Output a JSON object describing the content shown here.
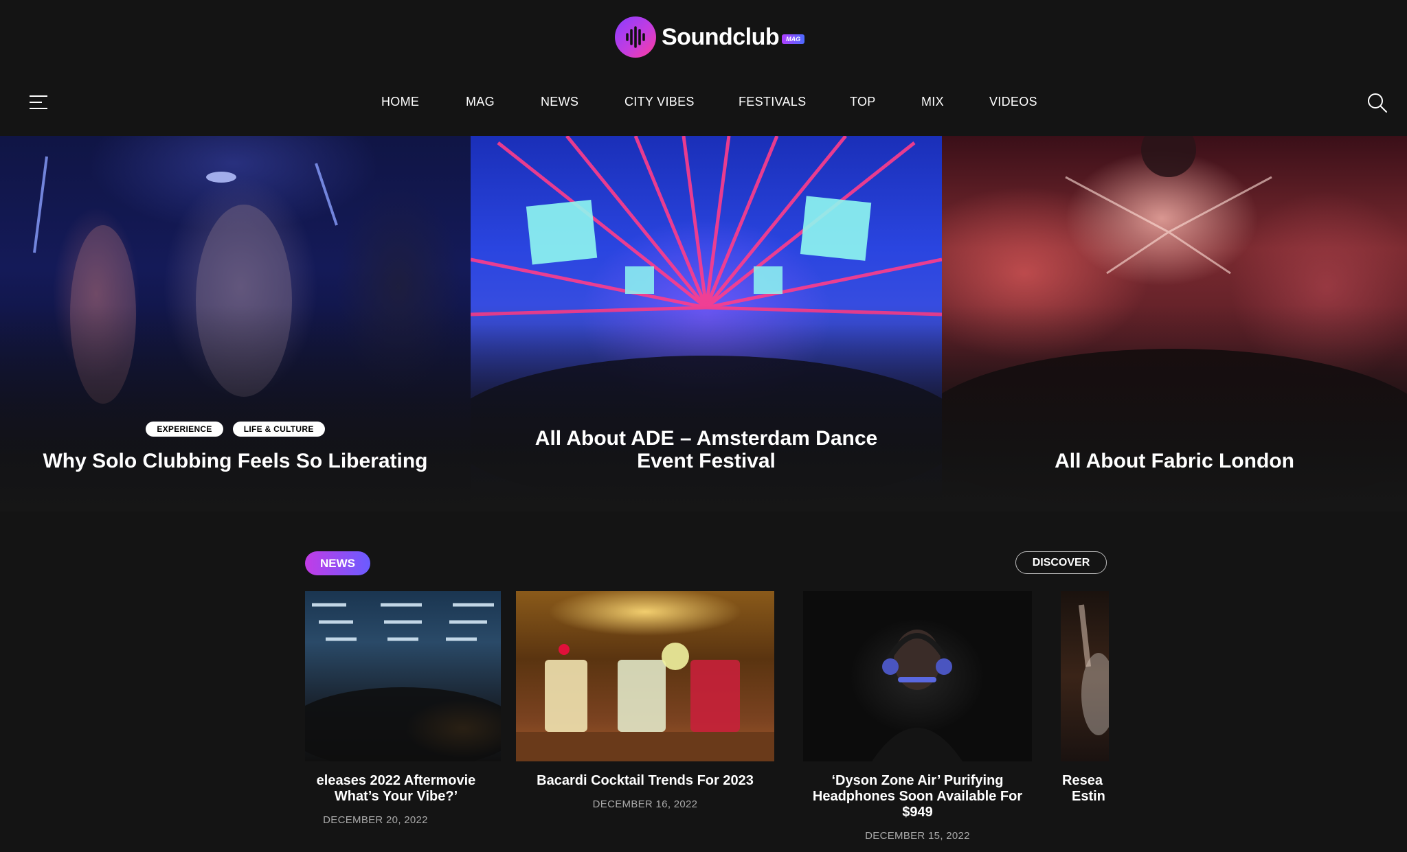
{
  "brand": {
    "name": "Soundclub",
    "badge": "MAG"
  },
  "nav": {
    "items": [
      "HOME",
      "MAG",
      "NEWS",
      "CITY VIBES",
      "FESTIVALS",
      "TOP",
      "MIX",
      "VIDEOS"
    ]
  },
  "hero": [
    {
      "tags": [
        "EXPERIENCE",
        "LIFE & CULTURE"
      ],
      "title": "Why Solo Clubbing Feels So Liberating"
    },
    {
      "title_line1": "All About ADE – Amsterdam Dance",
      "title_line2": "Event Festival"
    },
    {
      "title": "All About Fabric London"
    }
  ],
  "news": {
    "label": "NEWS",
    "discover_label": "DISCOVER",
    "cards": [
      {
        "title_line1": "eleases 2022 Aftermovie",
        "title_line2": "What’s Your Vibe?’",
        "date": "DECEMBER 20, 2022"
      },
      {
        "title": "Bacardi Cocktail Trends For 2023",
        "date": "DECEMBER 16, 2022"
      },
      {
        "title_line1": "‘Dyson Zone Air’ Purifying",
        "title_line2": "Headphones Soon Available For",
        "title_line3": "$949",
        "date": "DECEMBER 15, 2022"
      },
      {
        "title_line1": "Resea",
        "title_line2": "Estin"
      }
    ]
  },
  "icons": {
    "menu": "menu-icon",
    "search": "search-icon",
    "logo": "soundwave-logo-icon"
  },
  "colors": {
    "background": "#141414",
    "accent_start": "#c23ce6",
    "accent_end": "#6a5cff"
  }
}
